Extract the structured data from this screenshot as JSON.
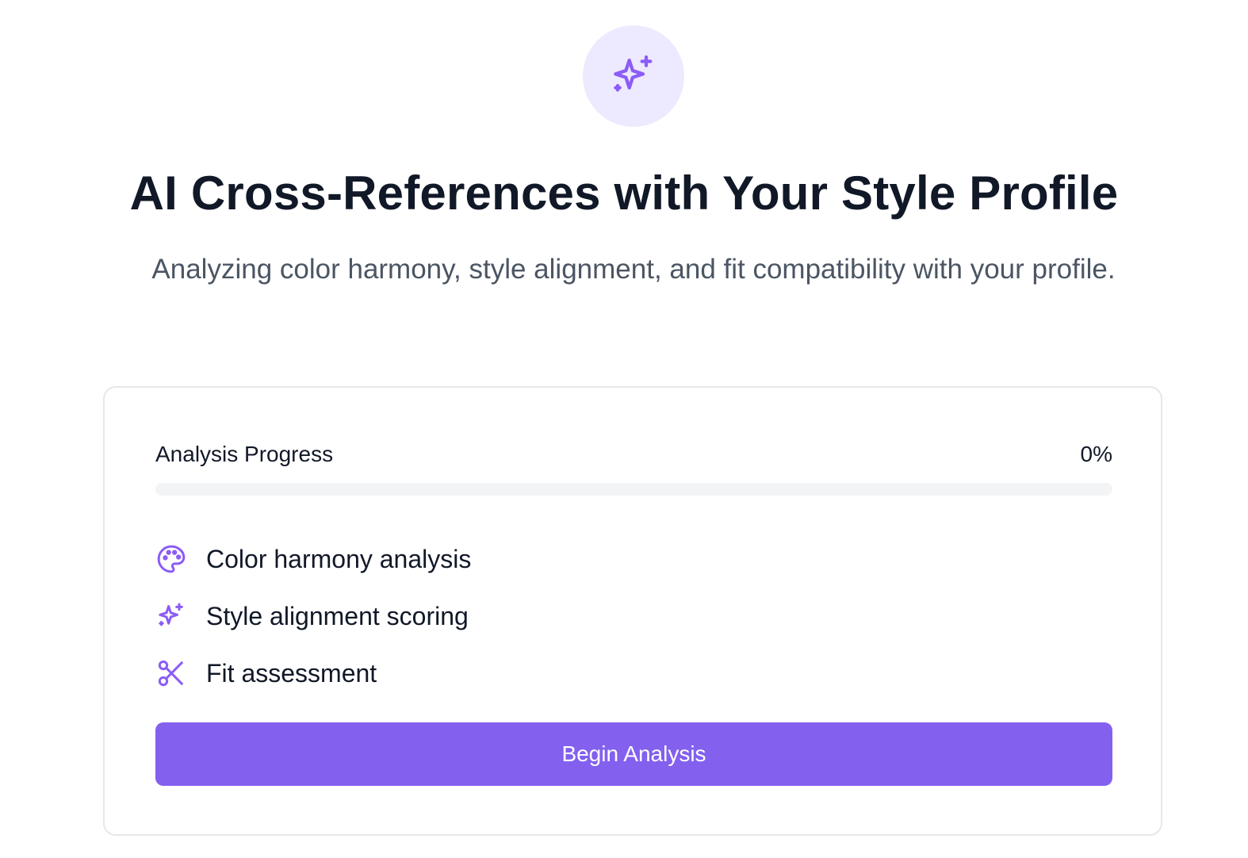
{
  "hero": {
    "icon": "sparkles-icon"
  },
  "header": {
    "title": "AI Cross-References with Your Style Profile",
    "subtitle": "Analyzing color harmony, style alignment, and fit compatibility with your profile."
  },
  "progress": {
    "label": "Analysis Progress",
    "value_text": "0%",
    "value": 0
  },
  "features": [
    {
      "icon": "palette-icon",
      "label": "Color harmony analysis"
    },
    {
      "icon": "sparkles-icon",
      "label": "Style alignment scoring"
    },
    {
      "icon": "scissors-icon",
      "label": "Fit assessment"
    }
  ],
  "actions": {
    "begin_label": "Begin Analysis"
  },
  "colors": {
    "accent": "#8360ee",
    "icon_accent": "#8b5cf6",
    "icon_bg": "#ede9fe",
    "track": "#f3f4f6"
  }
}
